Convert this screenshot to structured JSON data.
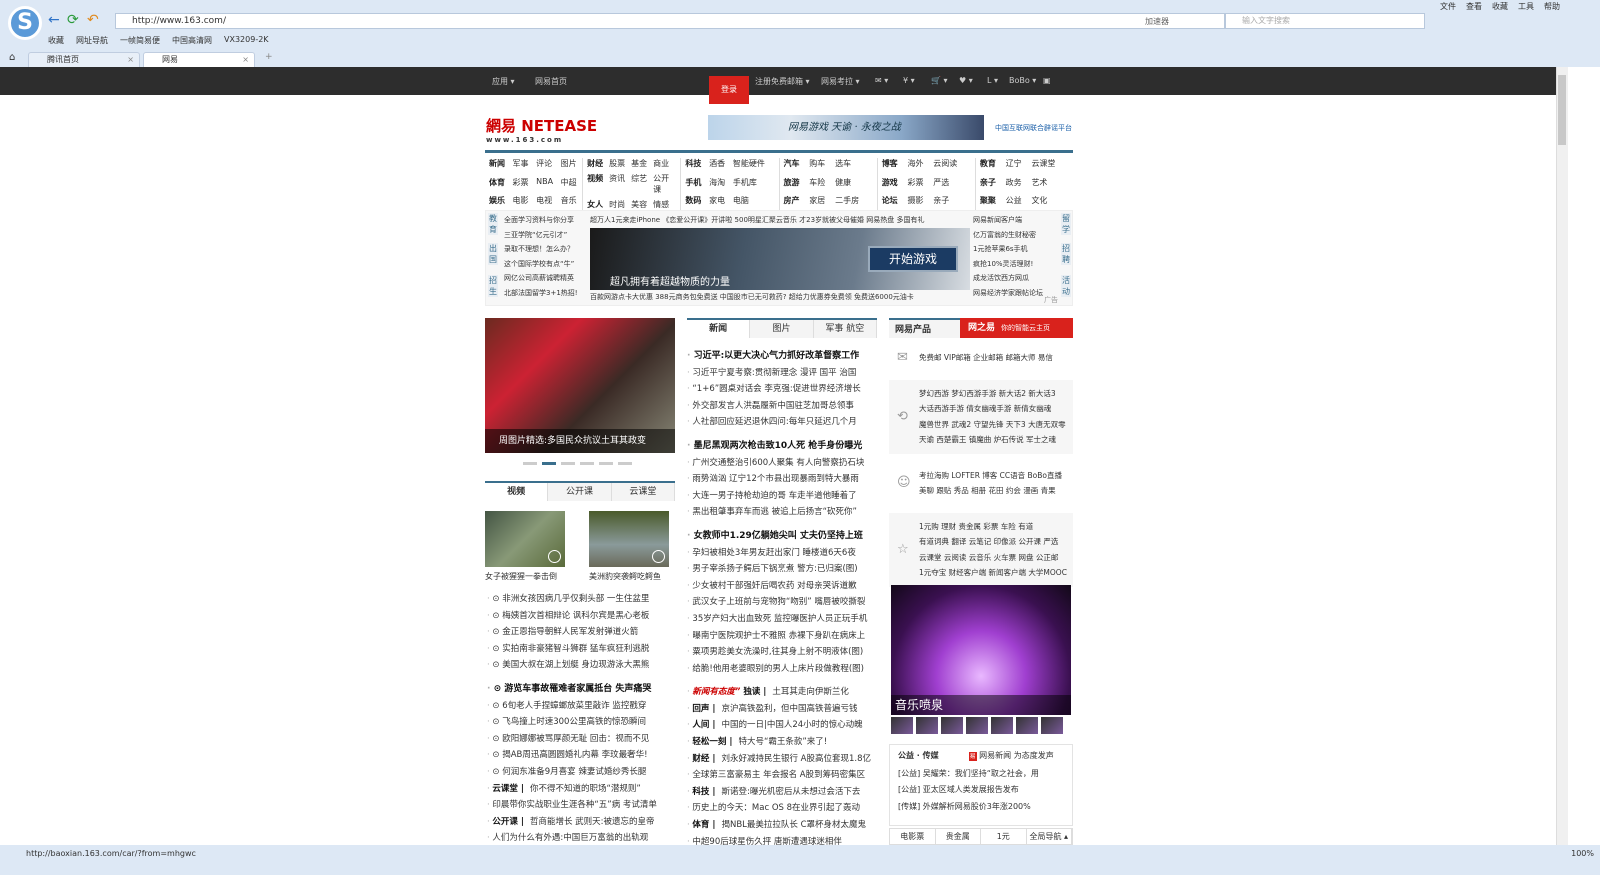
{
  "browser": {
    "url": "http://www.163.com/",
    "accelerator": "加速器",
    "search_placeholder": "输入文字搜索",
    "menu": [
      "文件",
      "查看",
      "收藏",
      "工具",
      "帮助"
    ],
    "bookmarks": [
      "收藏",
      "网址导航",
      "一帧简易便",
      "中国高清网",
      "VX3209-2K"
    ],
    "tabs": [
      {
        "label": "腾讯首页"
      },
      {
        "label": "网易"
      }
    ],
    "new_tab": "+",
    "close": "×",
    "status_url": "http://baoxian.163.com/car/?from=mhgwc",
    "zoom": "100%"
  },
  "topnav": {
    "left": [
      "应用 ▾",
      "网易首页"
    ],
    "login": "登录",
    "right": [
      "注册免费邮箱 ▾",
      "网易考拉 ▾",
      "✉ ▾",
      "¥ ▾",
      "🛒 ▾",
      "♥ ▾",
      "L ▾",
      "BoBo ▾",
      "▣"
    ]
  },
  "header": {
    "logo": "網易 NETEASE",
    "logo_sub": "www.163.com",
    "banner": "网易游戏 天谕 · 永夜之战",
    "partner": "中国互联网联合辟谣平台"
  },
  "channels": [
    [
      "新闻",
      "军事",
      "评论",
      "图片",
      "体育",
      "彩票",
      "NBA",
      "中超",
      "娱乐",
      "电影",
      "电视",
      "音乐"
    ],
    [
      "财经",
      "股票",
      "基金",
      "商业",
      "视频",
      "资讯",
      "综艺",
      "公开课",
      "女人",
      "时尚",
      "美容",
      "情感"
    ],
    [
      "科技",
      "酒香",
      "智能硬件",
      "",
      "手机",
      "海淘",
      "手机库",
      "",
      "数码",
      "家电",
      "电脑",
      ""
    ],
    [
      "汽车",
      "购车",
      "选车",
      "",
      "旅游",
      "车险",
      "健康",
      "",
      "房产",
      "家居",
      "二手房",
      ""
    ],
    [
      "博客",
      "海外",
      "云阅读",
      "",
      "游戏",
      "彩票",
      "严选",
      "",
      "论坛",
      "摄影",
      "亲子",
      ""
    ],
    [
      "教育",
      "辽宁",
      "云课堂",
      "",
      "亲子",
      "政务",
      "艺术",
      "",
      "聚聚",
      "公益",
      "文化",
      ""
    ]
  ],
  "adband": {
    "vleft": [
      "教育",
      "出国",
      "招生"
    ],
    "vright": [
      "留学",
      "招聘",
      "活动"
    ],
    "left": [
      "全面学习资料与你分享",
      "三亚学院“亿元引才”",
      "录取不理想！怎么办？",
      "这个国际学校有点“牛”",
      "网亿公司高薪诚聘精英",
      "北部法国留学3+1热招!"
    ],
    "top": "超万人1元来走iPhone 《恋爱公开课》开讲啦 500明星汇聚云音乐  才23岁就被父母催婚  网易热盘 多国有礼",
    "bottom": "百款网游点卡大优惠  388元商务包免费送  中国股市已无可救药?  超给力优惠券免费领  免费送6000元油卡",
    "right": [
      "网易新闻客户端",
      "亿万富翁的生财秘密",
      "1元抢苹果6s手机",
      "疯抢10%灵活理财!",
      "成龙活饮西方网瓜",
      "网易经济学家跟帖论坛"
    ],
    "caption": "超凡拥有着超越物质的力量",
    "cta": "开始游戏",
    "ad": "广告"
  },
  "left": {
    "photo_caption": "周图片精选:多国民众抗议土耳其政变",
    "tabs": [
      "视频",
      "公开课",
      "云课堂"
    ],
    "videos": [
      "女子被猩猩一拳击倒",
      "美洲豹突袭鳄吃鳄鱼"
    ],
    "list1": [
      "⊙ 非洲女孩因病几乎仅剩头部 一生住盆里",
      "⊙ 梅姨首次首相辩论 讽科尔宾是黑心老板",
      "⊙ 金正恩指导朝鲜人民军发射弹道火箭",
      "⊙ 实拍南非豪猪智斗狮群 猛车疯狂利逃脱",
      "⊙ 美国大叔在湖上划艇 身边现游泳大黑熊"
    ],
    "list2": [
      "⊙ 游览车事故罹难者家属抵台 失声痛哭",
      "⊙ 6旬老人手捏蟑螂放菜里敲诈 监控戳穿",
      "⊙ 飞鸟撞上时速300公里高铁的惊恐瞬间",
      "⊙ 欧阳娜娜被骂厚颜无耻 回击：视而不见",
      "⊙ 揭AB周迅高圆圆婚礼内幕 李玟最奢华!",
      "⊙ 何润东准备9月喜宴 辣妻试婚纱秀长腿"
    ],
    "list3": [
      {
        "k": "云课堂",
        "t": "你不得不知道的职场“潜规则”"
      },
      {
        "k": "",
        "t": "印晨带你实战职业生涯各种“五”病 考试清单"
      },
      {
        "k": "公开课",
        "t": "哲商能增长 武则天:被遗忘的皇帝"
      },
      {
        "k": "",
        "t": "人们为什么有外遇:中国巨万富翁的出轨观"
      }
    ]
  },
  "middle": {
    "tabs": [
      "新闻",
      "图片",
      "军事 航空"
    ],
    "groups": [
      [
        "习近平:以更大决心气力抓好改革督察工作",
        "习近平宁夏考察:贯彻新理念 漫评 国平 治国",
        "“1+6”圆桌对话会 李克强:促进世界经济增长",
        "外交部发言人洪磊履新中国驻芝加哥总领事",
        "人社部回应延迟退休四问:每年只延迟几个月"
      ],
      [
        "墨尼黑观两次枪击致10人死 枪手身份曝光",
        "广州交通整治引600人聚集 有人向警察扔石块",
        "雨势汹汹 辽宁12个市县出现暴雨到特大暴雨",
        "大连一男子持枪劫迫的哥 车走半道他睡着了",
        "黑出租肇事弃车而逃 被追上后扬言“砍死你”"
      ],
      [
        "女教师中1.29亿躺她尖叫 丈夫仍坚持上班",
        "孕妇被相处3年男友赶出家门 睡楼道6天6夜",
        "男子宰杀扬子鳄后下锅烹煮 警方:已归案(图)",
        "少女被村干部强奸后喝农药 对母亲哭诉道歉",
        "武汉女子上班前与宠物狗“吻别” 嘴唇被咬撕裂",
        "35岁产妇大出血致死 监控曝医护人员正玩手机",
        "曝南宁医院观护士不雅照 赤裸下身趴在病床上",
        "粟项男趁美女洗澡时,往其身上射不明液体(图)",
        "给脆!他用老婆眼别的男人上床片段做教程(图)"
      ]
    ],
    "special": {
      "brand": "新闻有态度",
      "k": "独读",
      "t": "土耳其走向伊斯兰化"
    },
    "items": [
      {
        "k": "回声",
        "t": "京沪高铁盈利，但中国高铁普遍亏钱"
      },
      {
        "k": "人间",
        "t": "中国的一日|中国人24小时的惊心动魄"
      },
      {
        "k": "轻松一刻",
        "t": "特大号“霸王条款”来了!"
      },
      {
        "k": "财经",
        "t": "刘永好减持民生银行 A股高位套现1.8亿"
      },
      {
        "k": "",
        "t": "全球第三富豪易主 年会报名 A股到筹码密集区"
      },
      {
        "k": "科技",
        "t": "斯诺登:曝光机密后从未想过会活下去"
      },
      {
        "k": "",
        "t": "历史上的今天：Mac OS 8在业界引起了轰动"
      },
      {
        "k": "体育",
        "t": "揭NBL最美拉拉队长 C罩杯身材太魔鬼"
      },
      {
        "k": "",
        "t": "中超90后球星伤久抨 唐斯遭遇球迷相伴"
      }
    ]
  },
  "right": {
    "title": "网易产品",
    "brand": "网之易",
    "slogan": "你的智能云主页",
    "rows": [
      {
        "icon": "mail-icon",
        "glyph": "✉",
        "lines": [
          "免费邮 VIP邮箱 企业邮箱 邮箱大师 易信"
        ]
      },
      {
        "icon": "game-mouse-icon",
        "glyph": "⟲",
        "lines": [
          "梦幻西游 梦幻西游手游 新大话2 新大话3",
          "大话西游手游 倩女幽魂手游 新倩女幽魂",
          "魔兽世界 武魂2 守望先锋 天下3 大唐无双零",
          "天谕 西楚霸王 镇魔曲 炉石传说 军士之魂"
        ]
      },
      {
        "icon": "smile-icon",
        "glyph": "☺",
        "lines": [
          "考拉海购 LOFTER 博客 CC语音 BoBo直播",
          "美聊 跟贴 秀品 相册 花田 约会 漫画 青果"
        ]
      },
      {
        "icon": "service-icon",
        "glyph": "☆",
        "lines": [
          "1元购 理财 贵金属 彩票 车险 有道",
          "有道词典 翻译 云笔记 印像派 公开课 严选",
          "云课堂 云阅读 云音乐 火车票 网盘 公正邮",
          "1元夺宝 财经客户端 新闻客户端 大学MOOC"
        ]
      }
    ],
    "fountain": "音乐喷泉",
    "gongyi": {
      "title": "公益 · 传媒",
      "app": "网易新闻 为态度发声",
      "lines": [
        "[公益] 吴耀荣：我们坚持“取之社会，用",
        "[公益] 亚太区域人类发展报告发布",
        "[传媒] 外媒解析网易股价3年涨200%"
      ]
    },
    "bottom_tabs": [
      "电影票",
      "贵金属",
      "1元",
      "全局导航 ▴"
    ]
  }
}
